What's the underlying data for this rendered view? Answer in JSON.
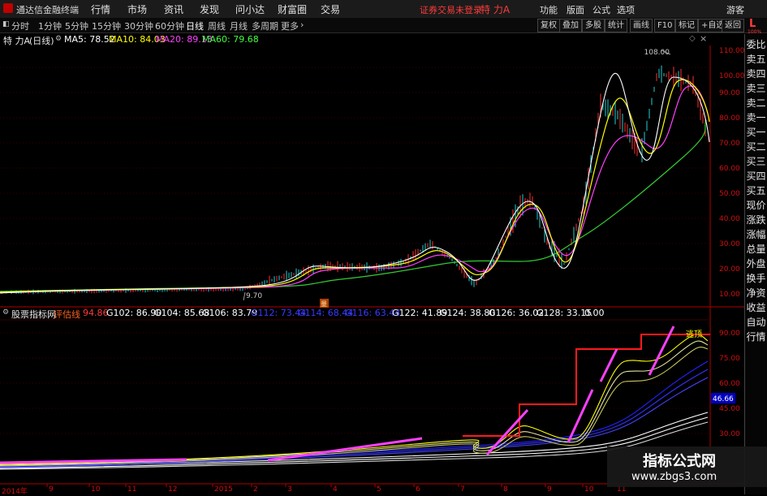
{
  "app": {
    "title": "通达信金融终端"
  },
  "menu": [
    "行情",
    "市场",
    "资讯",
    "发现",
    "问小达",
    "财富圈",
    "交易"
  ],
  "notice": "证券交易未登录",
  "stock": {
    "name": "特 力A",
    "period_label": "(日线)",
    "name_short": "特力A"
  },
  "right_menu": [
    "功能",
    "版面",
    "公式",
    "选项",
    "游客"
  ],
  "periods": [
    "分时",
    "1分钟",
    "5分钟",
    "15分钟",
    "30分钟",
    "60分钟",
    "日线",
    "周线",
    "月线",
    "多周期",
    "更多"
  ],
  "active_period": "日线",
  "toolbar": [
    "复权",
    "叠加",
    "多股",
    "统计",
    "画线",
    "F10",
    "标记",
    "+自选",
    "返回"
  ],
  "ma": {
    "ma5": {
      "label": "MA5: 78.52",
      "color": "#ffffff"
    },
    "ma10": {
      "label": "MA10: 84.03",
      "color": "#ffff00"
    },
    "ma20": {
      "label": "MA20: 89.13",
      "color": "#ff40ff"
    },
    "ma60": {
      "label": "MA60: 79.68",
      "color": "#40ff40"
    }
  },
  "price_axis": [
    "110.00",
    "100.00",
    "90.00",
    "80.00",
    "70.00",
    "60.00",
    "50.00",
    "40.00",
    "30.00",
    "20.00",
    "10.00"
  ],
  "annotations": {
    "high": "108.00",
    "low": "9.70",
    "marker": "量"
  },
  "indicator": {
    "name": "股票指标网",
    "label": "评估线",
    "first": "94.86",
    "values": [
      "G102: 86.90",
      "G104: 85.68",
      "G106: 83.79",
      "G112: 73.44",
      "G114: 68.44",
      "G116: 63.44",
      "G122: 41.89",
      "G124: 38.80",
      "G126: 36.02",
      "G128: 33.15",
      "0.00"
    ],
    "axis": [
      "90.00",
      "75.00",
      "60.00",
      "45.00",
      "30.00"
    ],
    "current": "46.66",
    "chart_text": "逃顶"
  },
  "side_panel": [
    "委比",
    "卖五",
    "卖四",
    "卖三",
    "卖二",
    "卖一",
    "买一",
    "买二",
    "买三",
    "买四",
    "买五",
    "现价",
    "涨跌",
    "涨幅",
    "总量",
    "外盘",
    "换手",
    "净资",
    "收益"
  ],
  "side_panel2": [
    "自动",
    "行情"
  ],
  "x_axis": [
    "2014年",
    "9",
    "10",
    "11",
    "12",
    "2015",
    "2",
    "3",
    "4",
    "5",
    "6",
    "7",
    "8",
    "9",
    "10",
    "11"
  ],
  "corner": {
    "l": "L",
    "badge": "100%"
  },
  "watermark": {
    "line1": "指标公式网",
    "line2": "www.zbgs3.com"
  }
}
